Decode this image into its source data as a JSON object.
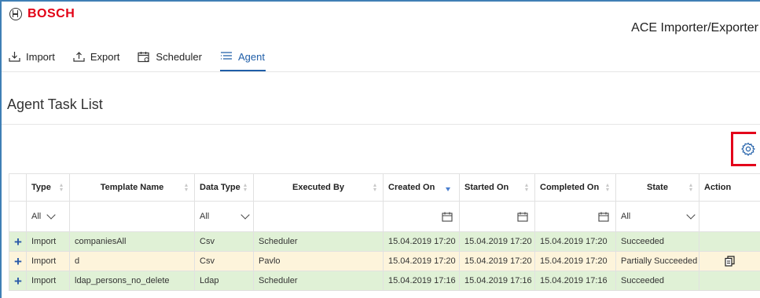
{
  "brand": {
    "name": "BOSCH",
    "color": "#e20015"
  },
  "app": {
    "title": "ACE Importer/Exporter"
  },
  "tabs": [
    {
      "label": "Import",
      "icon": "import-icon"
    },
    {
      "label": "Export",
      "icon": "export-icon"
    },
    {
      "label": "Scheduler",
      "icon": "calendar-icon"
    },
    {
      "label": "Agent",
      "icon": "list-icon",
      "active": true
    }
  ],
  "page": {
    "title": "Agent Task List"
  },
  "toolbar": {
    "settings_icon": "gear-icon",
    "highlight_color": "#e3001b"
  },
  "table": {
    "columns": [
      {
        "label": "Type"
      },
      {
        "label": "Template Name"
      },
      {
        "label": "Data Type"
      },
      {
        "label": "Executed By"
      },
      {
        "label": "Created On",
        "sorted": "desc"
      },
      {
        "label": "Started On"
      },
      {
        "label": "Completed On"
      },
      {
        "label": "State"
      },
      {
        "label": "Action"
      }
    ],
    "filters": {
      "type": "All",
      "data_type": "All",
      "state": "All"
    },
    "rows": [
      {
        "type": "Import",
        "template": "companiesAll",
        "data_type": "Csv",
        "executed_by": "Scheduler",
        "created": "15.04.2019 17:20",
        "started": "15.04.2019 17:20",
        "completed": "15.04.2019 17:20",
        "state": "Succeeded",
        "status_color": "#e0f1d6"
      },
      {
        "type": "Import",
        "template": "d",
        "data_type": "Csv",
        "executed_by": "Pavlo",
        "created": "15.04.2019 17:20",
        "started": "15.04.2019 17:20",
        "completed": "15.04.2019 17:20",
        "state": "Partially Succeeded",
        "status_color": "#fdf4db",
        "action_icon": "copy-icon"
      },
      {
        "type": "Import",
        "template": "ldap_persons_no_delete",
        "data_type": "Ldap",
        "executed_by": "Scheduler",
        "created": "15.04.2019 17:16",
        "started": "15.04.2019 17:16",
        "completed": "15.04.2019 17:16",
        "state": "Succeeded",
        "status_color": "#e0f1d6"
      }
    ]
  }
}
